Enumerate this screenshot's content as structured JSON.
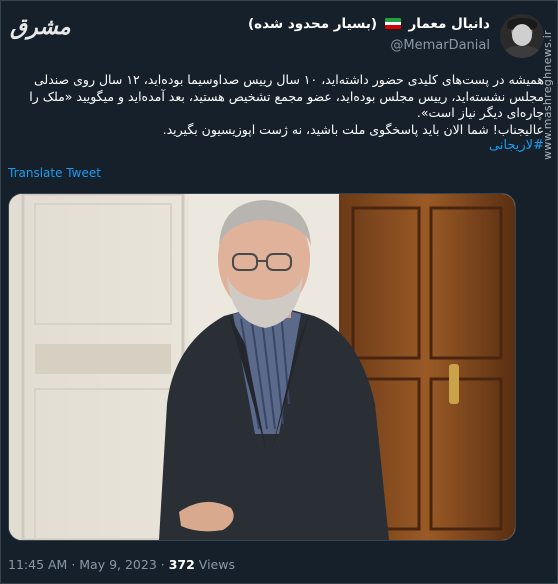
{
  "tweet": {
    "display_name": "دانیال معمار (بسیار محدود شده)",
    "handle": "@MemarDanial",
    "text_lines": [
      "همیشه در پست‌های کلیدی حضور داشته‌اید، ۱۰ سال رییس صداوسیما بوده‌اید، ۱۲ سال روی صندلی",
      "مجلس نشسته‌اید، رییس مجلس بوده‌اید، عضو مجمع تشخیص هستید، بعد آمده‌اید و میگویید «ملک را",
      "چاره‌ای دیگر نیاز است».",
      "عالیجناب! شما الان باید پاسخگوی ملت باشید، نه ژست اپوزیسیون بگیرید."
    ],
    "hashtag": "#لاریجانی",
    "translate_label": "Translate Tweet",
    "time": "11:45 AM",
    "date": "May 9, 2023",
    "views_count": "372",
    "views_label": "Views"
  },
  "branding": {
    "logo_text": "مشرق",
    "watermark": "www.mashreghnews.ir"
  },
  "icons": {
    "flag": "iran-flag-icon",
    "avatar": "avatar-icon"
  },
  "colors": {
    "background": "#15202b",
    "link": "#1d9bf0",
    "secondary_text": "#8b98a5",
    "border": "#38444d"
  }
}
